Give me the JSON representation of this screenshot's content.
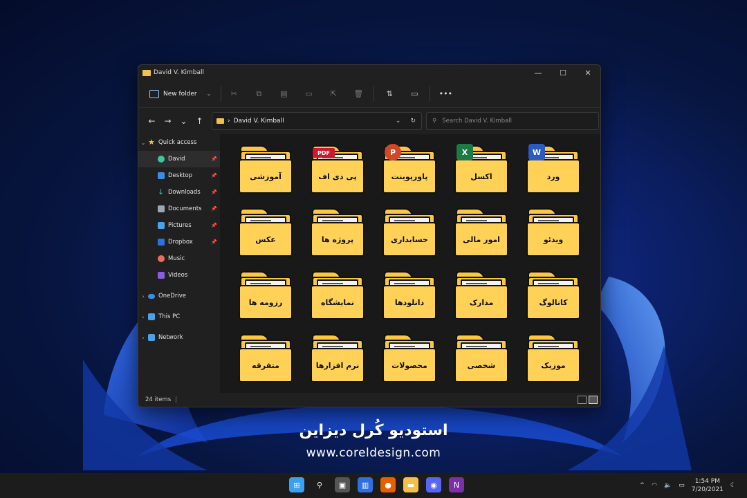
{
  "window": {
    "title": "David V. Kimball",
    "controls": [
      "—",
      "☐",
      "✕"
    ]
  },
  "toolbar": {
    "new_folder": "New folder",
    "sort_icon": "⇅",
    "view_icon": "▭",
    "more_icon": "•••"
  },
  "navbar": {
    "back": "←",
    "forward": "→",
    "recent": "⌄",
    "up": "↑",
    "path_sep": "›",
    "path": "David V. Kimball",
    "search_placeholder": "Search David V. Kimball"
  },
  "sidebar": {
    "items": [
      {
        "label": "Quick access",
        "icon": "star-icon",
        "color": "#f5c04a"
      },
      {
        "label": "David",
        "icon": "user-icon",
        "color": "#3fc4a0"
      },
      {
        "label": "Desktop",
        "icon": "desktop-icon",
        "color": "#3b8de0"
      },
      {
        "label": "Downloads",
        "icon": "download-icon",
        "color": "#3fc4a0"
      },
      {
        "label": "Documents",
        "icon": "document-icon",
        "color": "#9aa7b5"
      },
      {
        "label": "Pictures",
        "icon": "pictures-icon",
        "color": "#4aa3e8"
      },
      {
        "label": "Dropbox",
        "icon": "dropbox-icon",
        "color": "#2f6fe0"
      },
      {
        "label": "Music",
        "icon": "music-icon",
        "color": "#e8705a"
      },
      {
        "label": "Videos",
        "icon": "videos-icon",
        "color": "#8a5ce0"
      },
      {
        "label": "OneDrive",
        "icon": "onedrive-icon",
        "color": "#3b8de0"
      },
      {
        "label": "This PC",
        "icon": "pc-icon",
        "color": "#4aa3e8"
      },
      {
        "label": "Network",
        "icon": "network-icon",
        "color": "#4aa3e8"
      }
    ]
  },
  "folders": [
    {
      "label": "آموزشی"
    },
    {
      "label": "پی دی اف",
      "badge": "PDF",
      "badge_color": "#d0182c"
    },
    {
      "label": "پاورپوینت",
      "badge": "P",
      "badge_color": "#d24726"
    },
    {
      "label": "اکسل",
      "badge": "X",
      "badge_color": "#1d7a45"
    },
    {
      "label": "ورد",
      "badge": "W",
      "badge_color": "#2b5bbf"
    },
    {
      "label": "عکس"
    },
    {
      "label": "پروژه ها"
    },
    {
      "label": "حسابداری"
    },
    {
      "label": "امور مالی"
    },
    {
      "label": "ویدئو"
    },
    {
      "label": "رزومه ها"
    },
    {
      "label": "نمایشگاه"
    },
    {
      "label": "دانلودها"
    },
    {
      "label": "مدارک"
    },
    {
      "label": "کاتالوگ"
    },
    {
      "label": "متفرقه"
    },
    {
      "label": "نرم افزارها"
    },
    {
      "label": "محصولات"
    },
    {
      "label": "شخصی"
    },
    {
      "label": "موزیک"
    }
  ],
  "status": {
    "count": "24 items"
  },
  "brand": {
    "name": "استودیو کُرل دیزاین",
    "url": "www.coreldesign.com"
  },
  "taskbar": {
    "apps": [
      {
        "name": "windows-start-icon",
        "color": "#3ba0f0",
        "glyph": "⊞"
      },
      {
        "name": "search-icon",
        "color": "transparent",
        "glyph": "⚲"
      },
      {
        "name": "task-view-icon",
        "color": "#555555",
        "glyph": "▣"
      },
      {
        "name": "widgets-icon",
        "color": "#2f6fe0",
        "glyph": "▥"
      },
      {
        "name": "firefox-icon",
        "color": "#e66000",
        "glyph": "●"
      },
      {
        "name": "file-explorer-icon",
        "color": "#f5c04a",
        "glyph": "▬"
      },
      {
        "name": "discord-icon",
        "color": "#5865f2",
        "glyph": "◉"
      },
      {
        "name": "onenote-icon",
        "color": "#7b2fa8",
        "glyph": "N"
      }
    ],
    "tray_chevron": "^",
    "time": "1:54 PM",
    "date": "7/20/2021"
  }
}
